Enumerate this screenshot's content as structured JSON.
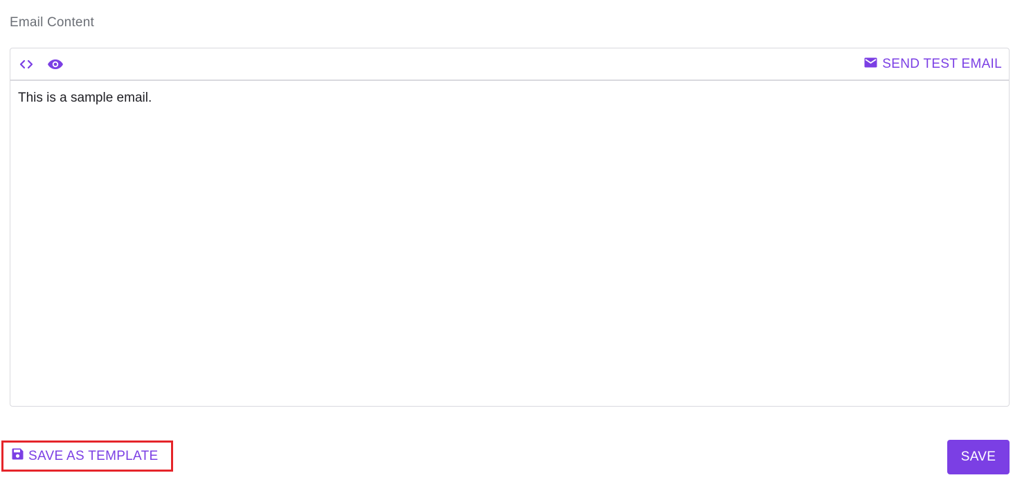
{
  "section": {
    "label": "Email Content"
  },
  "toolbar": {
    "icons": [
      "code-icon",
      "eye-icon",
      "mail-icon"
    ],
    "send_test_label": "SEND TEST EMAIL"
  },
  "editor": {
    "content": "This is a sample email."
  },
  "footer": {
    "save_as_template_label": "SAVE AS TEMPLATE",
    "save_as_template_icon": "floppy-disk-icon",
    "save_label": "SAVE"
  },
  "colors": {
    "accent": "#7b3fe4",
    "highlight_border": "#e5252a",
    "border": "#d9d9de",
    "label_text": "#6b6f76"
  }
}
